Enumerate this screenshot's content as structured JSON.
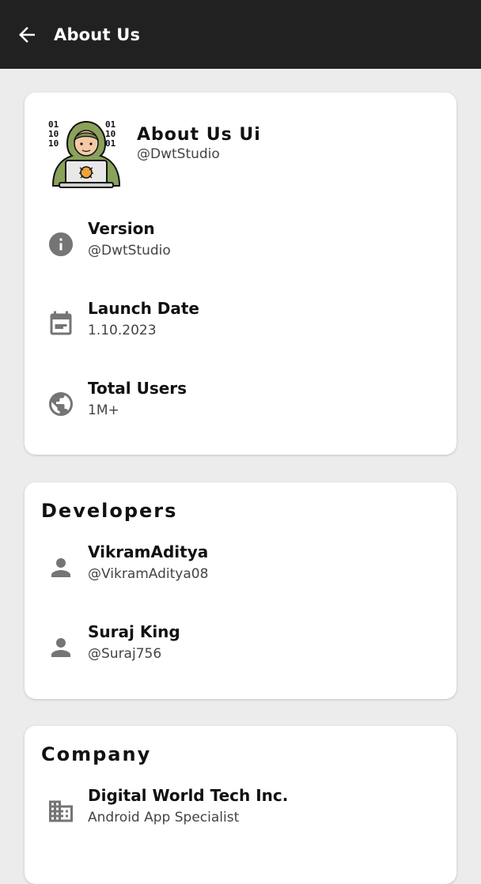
{
  "appbar": {
    "title": "About Us",
    "back_icon": "arrow-back-icon"
  },
  "app_card": {
    "name": "About Us Ui",
    "handle": "@DwtStudio",
    "logo_icon": "hacker-laptop-logo",
    "logo_binary": [
      "01",
      "10",
      "10",
      "01",
      "10",
      "01"
    ],
    "items": [
      {
        "icon": "info-icon",
        "title": "Version",
        "subtitle": "@DwtStudio"
      },
      {
        "icon": "calendar-icon",
        "title": "Launch Date",
        "subtitle": "1.10.2023"
      },
      {
        "icon": "globe-icon",
        "title": "Total Users",
        "subtitle": "1M+"
      }
    ]
  },
  "developers": {
    "title": "Developers",
    "items": [
      {
        "icon": "person-icon",
        "title": "VikramAditya",
        "subtitle": "@VikramAditya08"
      },
      {
        "icon": "person-icon",
        "title": "Suraj King",
        "subtitle": "@Suraj756"
      }
    ]
  },
  "company": {
    "title": "Company",
    "items": [
      {
        "icon": "building-icon",
        "title": "Digital World Tech Inc.",
        "subtitle": "Android App Specialist"
      }
    ]
  },
  "colors": {
    "appbar": "#212121",
    "background": "#ececec",
    "card": "#ffffff",
    "icon": "#757575"
  }
}
